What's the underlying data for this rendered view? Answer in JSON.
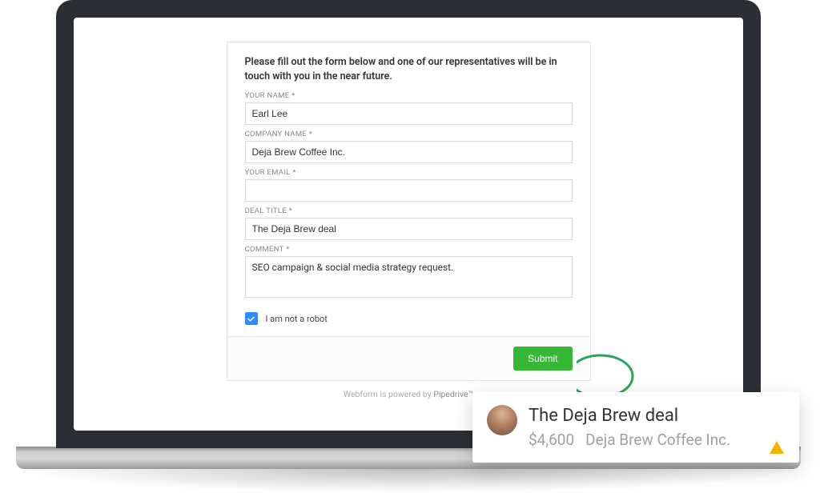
{
  "form": {
    "intro": "Please fill out the form below and one of our representatives will be in touch with you in the near future.",
    "fields": {
      "name": {
        "label": "YOUR NAME *",
        "value": "Earl Lee"
      },
      "company": {
        "label": "COMPANY NAME *",
        "value": "Deja Brew Coffee Inc."
      },
      "email": {
        "label": "YOUR EMAIL *",
        "value": ""
      },
      "deal_title": {
        "label": "DEAL TITLE *",
        "value": "The Deja Brew deal"
      },
      "comment": {
        "label": "COMMENT *",
        "value": "SEO campaign & social media strategy request."
      }
    },
    "recaptcha_label": "I am not a robot",
    "submit_label": "Submit",
    "powered_prefix": "Webform is powered by ",
    "powered_brand": "Pipedrive™"
  },
  "deal_card": {
    "title": "The Deja Brew deal",
    "amount": "$4,600",
    "company": "Deja Brew Coffee Inc."
  }
}
